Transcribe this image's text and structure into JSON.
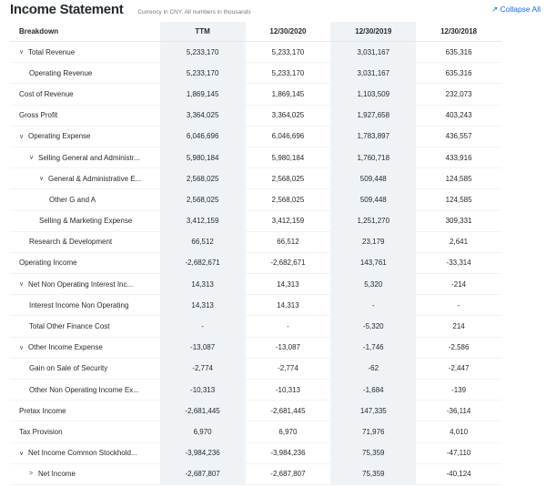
{
  "header": {
    "title": "Income Statement",
    "subtitle": "Currency in CNY. All numbers in thousands",
    "collapse_label": "Collapse All",
    "collapse_icon": "collapse-arrows-icon"
  },
  "columns": [
    "Breakdown",
    "TTM",
    "12/30/2020",
    "12/30/2019",
    "12/30/2018"
  ],
  "rows": [
    {
      "label": "Total Revenue",
      "level": 0,
      "toggle": "expanded",
      "values": [
        "5,233,170",
        "5,233,170",
        "3,031,167",
        "635,316"
      ]
    },
    {
      "label": "Operating Revenue",
      "level": 1,
      "toggle": "none",
      "values": [
        "5,233,170",
        "5,233,170",
        "3,031,167",
        "635,316"
      ]
    },
    {
      "label": "Cost of Revenue",
      "level": 0,
      "toggle": "none",
      "values": [
        "1,869,145",
        "1,869,145",
        "1,103,509",
        "232,073"
      ]
    },
    {
      "label": "Gross Profit",
      "level": 0,
      "toggle": "none",
      "values": [
        "3,364,025",
        "3,364,025",
        "1,927,658",
        "403,243"
      ]
    },
    {
      "label": "Operating Expense",
      "level": 0,
      "toggle": "expanded",
      "values": [
        "6,046,696",
        "6,046,696",
        "1,783,897",
        "436,557"
      ]
    },
    {
      "label": "Selling General and Administr...",
      "level": 1,
      "toggle": "expanded",
      "values": [
        "5,980,184",
        "5,980,184",
        "1,760,718",
        "433,916"
      ]
    },
    {
      "label": "General & Administrative E...",
      "level": 2,
      "toggle": "expanded",
      "values": [
        "2,568,025",
        "2,568,025",
        "509,448",
        "124,585"
      ]
    },
    {
      "label": "Other G and A",
      "level": 3,
      "toggle": "none",
      "values": [
        "2,568,025",
        "2,568,025",
        "509,448",
        "124,585"
      ]
    },
    {
      "label": "Selling & Marketing Expense",
      "level": 2,
      "toggle": "none",
      "values": [
        "3,412,159",
        "3,412,159",
        "1,251,270",
        "309,331"
      ]
    },
    {
      "label": "Research & Development",
      "level": 1,
      "toggle": "none",
      "values": [
        "66,512",
        "66,512",
        "23,179",
        "2,641"
      ]
    },
    {
      "label": "Operating Income",
      "level": 0,
      "toggle": "none",
      "values": [
        "-2,682,671",
        "-2,682,671",
        "143,761",
        "-33,314"
      ]
    },
    {
      "label": "Net Non Operating Interest Inc...",
      "level": 0,
      "toggle": "expanded",
      "values": [
        "14,313",
        "14,313",
        "5,320",
        "-214"
      ]
    },
    {
      "label": "Interest Income Non Operating",
      "level": 1,
      "toggle": "none",
      "values": [
        "14,313",
        "14,313",
        "-",
        "-"
      ]
    },
    {
      "label": "Total Other Finance Cost",
      "level": 1,
      "toggle": "none",
      "values": [
        "-",
        "-",
        "-5,320",
        "214"
      ]
    },
    {
      "label": "Other Income Expense",
      "level": 0,
      "toggle": "expanded",
      "values": [
        "-13,087",
        "-13,087",
        "-1,746",
        "-2,586"
      ]
    },
    {
      "label": "Gain on Sale of Security",
      "level": 1,
      "toggle": "none",
      "values": [
        "-2,774",
        "-2,774",
        "-62",
        "-2,447"
      ]
    },
    {
      "label": "Other Non Operating Income Ex...",
      "level": 1,
      "toggle": "none",
      "values": [
        "-10,313",
        "-10,313",
        "-1,684",
        "-139"
      ]
    },
    {
      "label": "Pretax Income",
      "level": 0,
      "toggle": "none",
      "values": [
        "-2,681,445",
        "-2,681,445",
        "147,335",
        "-36,114"
      ]
    },
    {
      "label": "Tax Provision",
      "level": 0,
      "toggle": "none",
      "values": [
        "6,970",
        "6,970",
        "71,976",
        "4,010"
      ]
    },
    {
      "label": "Net Income Common Stockhold...",
      "level": 0,
      "toggle": "expanded",
      "values": [
        "-3,984,236",
        "-3,984,236",
        "75,359",
        "-47,110"
      ]
    },
    {
      "label": "Net Income",
      "level": 1,
      "toggle": "collapsed",
      "values": [
        "-2,687,807",
        "-2,687,807",
        "75,359",
        "-40,124"
      ]
    }
  ]
}
